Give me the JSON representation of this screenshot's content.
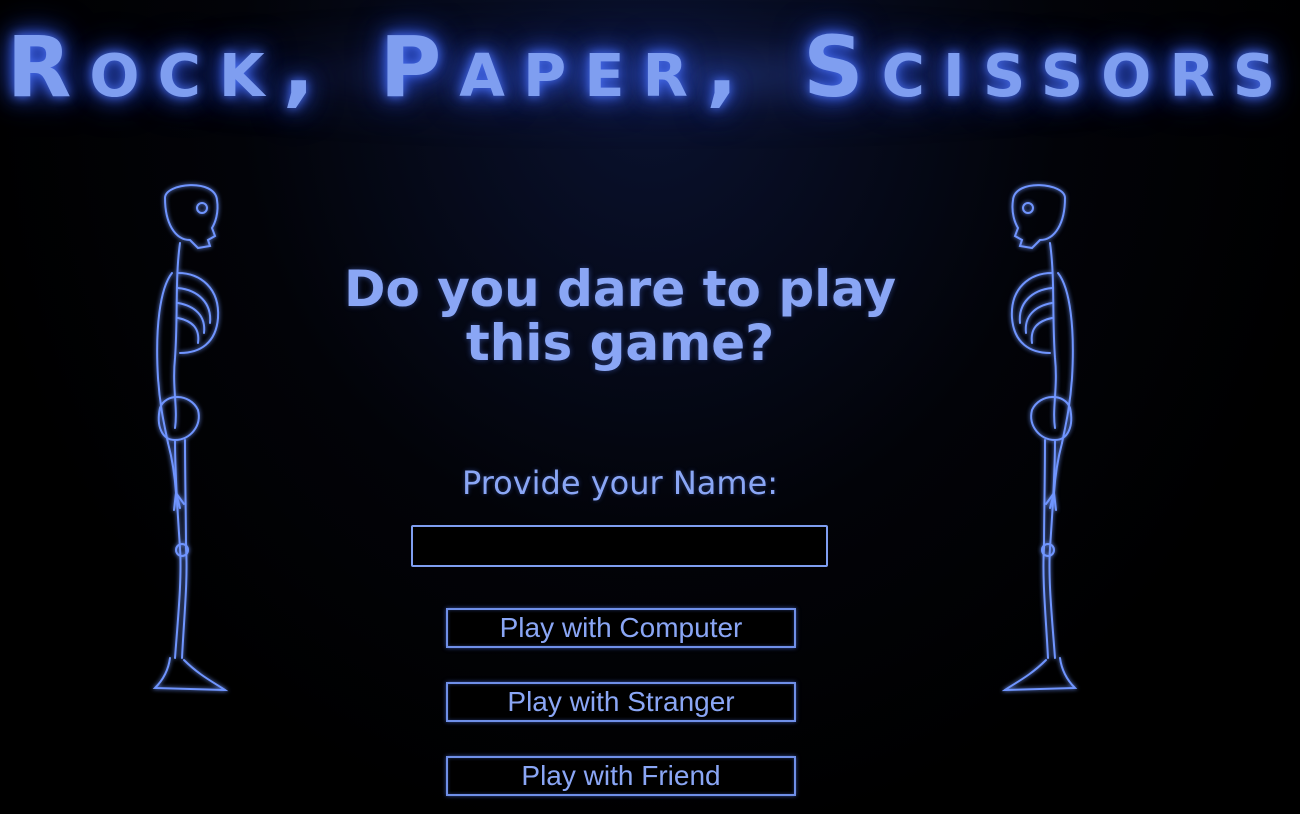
{
  "header": {
    "title": "Rock, Paper, Scissors"
  },
  "main": {
    "question": "Do you dare to play this game?",
    "name_label": "Provide your Name:",
    "name_input": {
      "value": "",
      "placeholder": ""
    },
    "buttons": {
      "computer": "Play with Computer",
      "stranger": "Play with Stranger",
      "friend": "Play with Friend"
    }
  },
  "decorations": {
    "left_figure": "skeleton-icon",
    "right_figure": "skeleton-icon"
  },
  "colors": {
    "background": "#000000",
    "accent": "#7f9ef0",
    "glow": "#4a6ff0"
  }
}
